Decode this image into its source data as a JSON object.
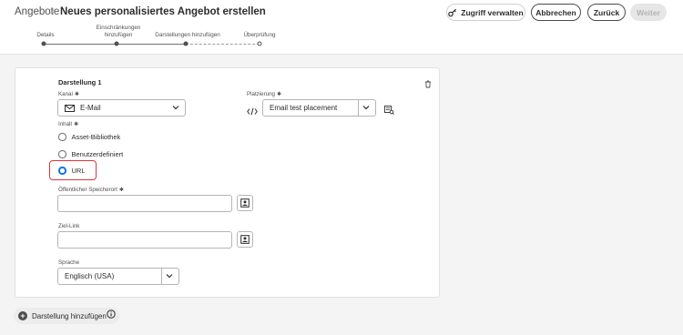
{
  "header": {
    "breadcrumb_root": "Angebote",
    "breadcrumb_separator": ">",
    "title": "Neues personalisiertes Angebot erstellen",
    "buttons": {
      "access": "Zugriff verwalten",
      "cancel": "Abbrechen",
      "back": "Zurück",
      "next": "Weiter"
    }
  },
  "steps": [
    {
      "line1": "",
      "line2": "Details",
      "state": "done"
    },
    {
      "line1": "Einschränkungen",
      "line2": "hinzufügen",
      "state": "done"
    },
    {
      "line1": "",
      "line2": "Darstellungen hinzufügen",
      "state": "current"
    },
    {
      "line1": "",
      "line2": "Überprüfung",
      "state": "pending"
    }
  ],
  "representation": {
    "title": "Darstellung 1",
    "channel_label": "Kanal",
    "channel_value": "E-Mail",
    "placement_label": "Platzierung",
    "placement_value": "Email test placement",
    "content_label": "Inhalt",
    "content_options": [
      "Asset-Bibliothek",
      "Benutzerdefiniert",
      "URL"
    ],
    "content_selected": "URL",
    "public_location_label": "Öffentlicher Speicherort",
    "public_location_value": "",
    "target_link_label": "Ziel-Link",
    "target_link_value": "",
    "language_label": "Sprache",
    "language_value": "Englisch (USA)",
    "required_marker": "✱"
  },
  "footer": {
    "add_representation": "Darstellung hinzufügen"
  },
  "colors": {
    "accent_blue": "#1473e6",
    "highlight_red": "#d7373f",
    "disabled_bg": "#e6e6e6"
  }
}
